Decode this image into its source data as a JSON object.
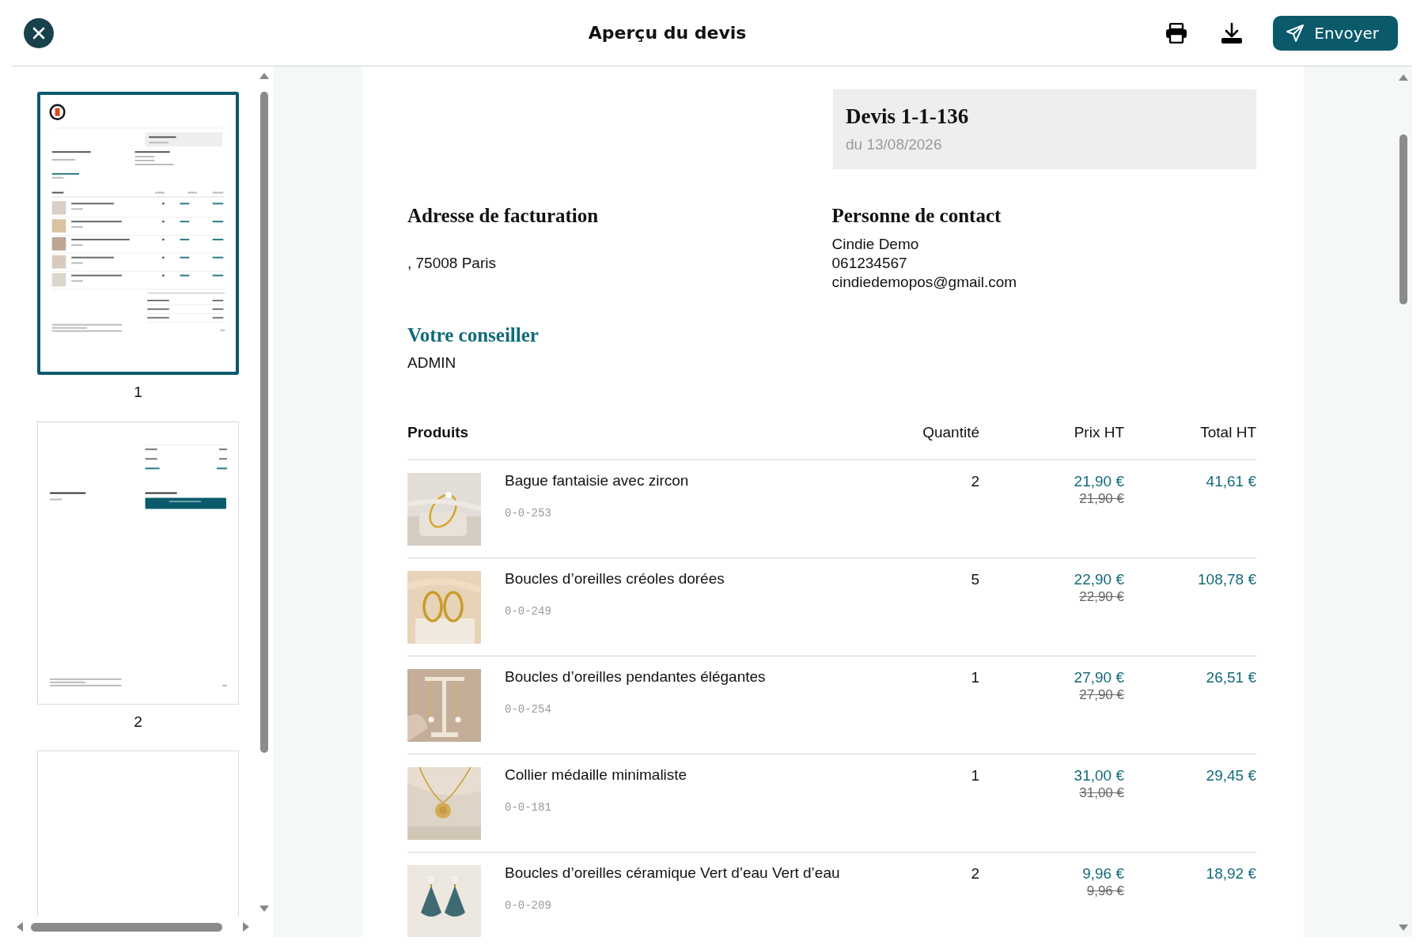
{
  "header": {
    "title": "Aperçu du devis",
    "send_button": "Envoyer"
  },
  "thumbnails": [
    {
      "label": "1",
      "selected": true
    },
    {
      "label": "2",
      "selected": false
    },
    {
      "selected": false
    }
  ],
  "quote": {
    "title": "Devis 1-1-136",
    "date": "du 13/08/2026"
  },
  "billing": {
    "heading": "Adresse de facturation",
    "lines": [
      ", 75008 Paris"
    ]
  },
  "contact": {
    "heading": "Personne de contact",
    "lines": [
      "Cindie Demo",
      "061234567",
      "cindiedemopos@gmail.com"
    ]
  },
  "advisor": {
    "heading": "Votre conseiller",
    "name": "ADMIN"
  },
  "table": {
    "columns": [
      "Produits",
      "Quantité",
      "Prix HT",
      "Total HT"
    ],
    "rows": [
      {
        "name": "Bague fantaisie avec zircon",
        "ref": "0-0-253",
        "quantity": "2",
        "price": "21,90 €",
        "old_price": "21,90 €",
        "total": "41,61 €"
      },
      {
        "name": "Boucles d’oreilles créoles dorées",
        "ref": "0-0-249",
        "quantity": "5",
        "price": "22,90 €",
        "old_price": "22,90 €",
        "total": "108,78 €"
      },
      {
        "name": "Boucles d’oreilles pendantes élégantes",
        "ref": "0-0-254",
        "quantity": "1",
        "price": "27,90 €",
        "old_price": "27,90 €",
        "total": "26,51 €"
      },
      {
        "name": "Collier médaille minimaliste",
        "ref": "0-0-181",
        "quantity": "1",
        "price": "31,00 €",
        "old_price": "31,00 €",
        "total": "29,45 €"
      },
      {
        "name": "Boucles d’oreilles céramique Vert d’eau Vert d’eau",
        "ref": "0-0-209",
        "quantity": "2",
        "price": "9,96 €",
        "old_price": "9,96 €",
        "total": "18,92 €"
      }
    ]
  }
}
